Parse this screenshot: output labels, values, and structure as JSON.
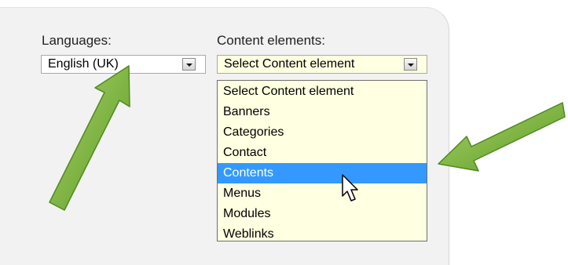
{
  "languages": {
    "label": "Languages:",
    "selected": "English (UK)"
  },
  "content_elements": {
    "label": "Content elements:",
    "selected": "Select Content element",
    "options": [
      "Select Content element",
      "Banners",
      "Categories",
      "Contact",
      "Contents",
      "Menus",
      "Modules",
      "Weblinks"
    ],
    "highlighted": "Contents"
  },
  "colors": {
    "panel": "#f2f2f2",
    "dropdown_bg": "#ffffe1",
    "highlight": "#3399ff",
    "arrow": "#7bb33a"
  },
  "icons": {
    "dropdown_button": "chevron-down-icon",
    "pointer": "mouse-pointer-icon",
    "annotation": "arrow-icon"
  }
}
